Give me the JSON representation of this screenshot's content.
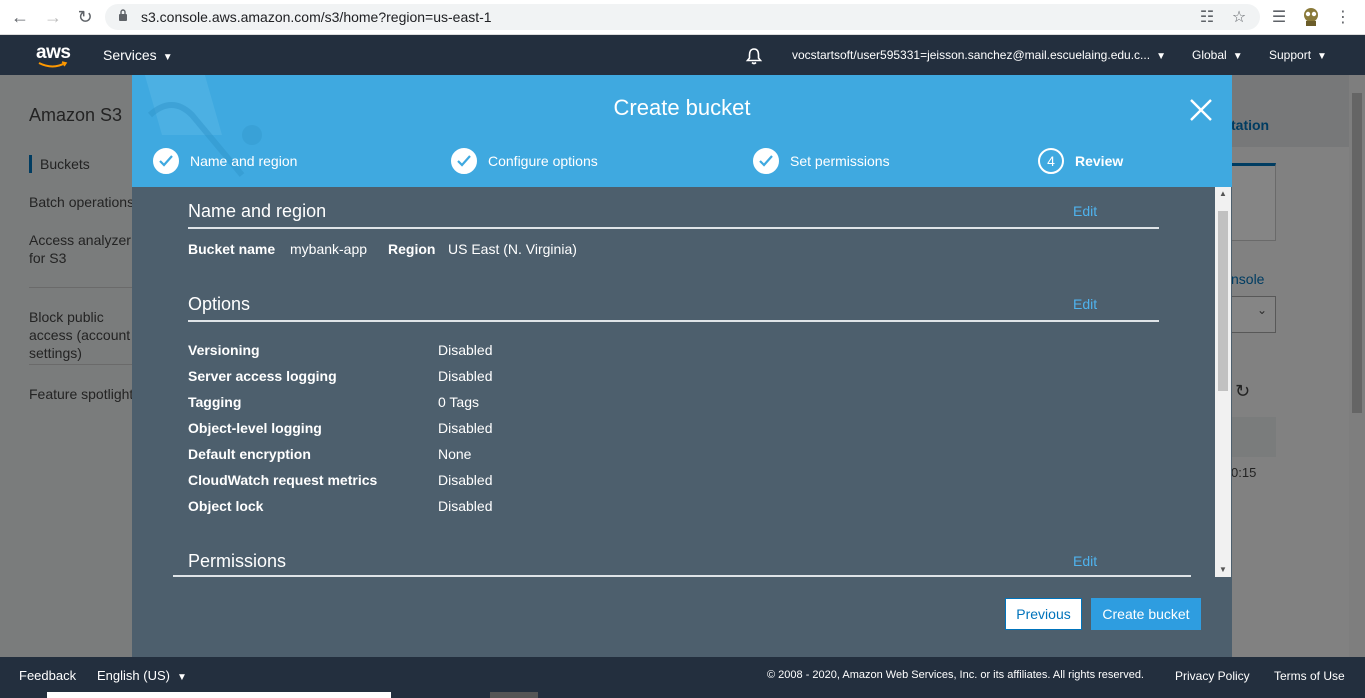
{
  "browser": {
    "url": "s3.console.aws.amazon.com/s3/home?region=us-east-1"
  },
  "topnav": {
    "logo": "aws",
    "services": "Services",
    "account": "vocstartsoft/user595331=jeisson.sanchez@mail.escuelaing.edu.c...",
    "region": "Global",
    "support": "Support"
  },
  "sidebar": {
    "title": "Amazon S3",
    "items": [
      {
        "label": "Buckets"
      },
      {
        "label": "Batch operations"
      },
      {
        "label": "Access analyzer for S3"
      },
      {
        "label": "Block public access (account settings)"
      },
      {
        "label": "Feature spotlight"
      }
    ]
  },
  "background_right": {
    "tab": "tation",
    "link": "nsole",
    "time": "0:15"
  },
  "modal": {
    "title": "Create bucket",
    "steps": [
      {
        "label": "Name and region",
        "state": "done"
      },
      {
        "label": "Configure options",
        "state": "done"
      },
      {
        "label": "Set permissions",
        "state": "done"
      },
      {
        "label": "Review",
        "number": "4",
        "state": "current"
      }
    ],
    "name_section": {
      "title": "Name and region",
      "edit": "Edit",
      "bucket_name_label": "Bucket name",
      "bucket_name": "mybank-app",
      "region_label": "Region",
      "region": "US East (N. Virginia)"
    },
    "options_section": {
      "title": "Options",
      "edit": "Edit",
      "rows": [
        {
          "label": "Versioning",
          "value": "Disabled"
        },
        {
          "label": "Server access logging",
          "value": "Disabled"
        },
        {
          "label": "Tagging",
          "value": "0 Tags"
        },
        {
          "label": "Object-level logging",
          "value": "Disabled"
        },
        {
          "label": "Default encryption",
          "value": "None"
        },
        {
          "label": "CloudWatch request metrics",
          "value": "Disabled"
        },
        {
          "label": "Object lock",
          "value": "Disabled"
        }
      ]
    },
    "permissions_section": {
      "title": "Permissions",
      "edit": "Edit"
    },
    "buttons": {
      "previous": "Previous",
      "create": "Create bucket"
    }
  },
  "footer": {
    "feedback": "Feedback",
    "language": "English (US)",
    "copyright": "© 2008 - 2020, Amazon Web Services, Inc. or its affiliates. All rights reserved.",
    "privacy": "Privacy Policy",
    "terms": "Terms of Use"
  },
  "colors": {
    "header_blue": "#3fa9e0",
    "modal_body": "#4d5f6d",
    "aws_nav": "#232f3e",
    "link_blue": "#0073bb"
  }
}
